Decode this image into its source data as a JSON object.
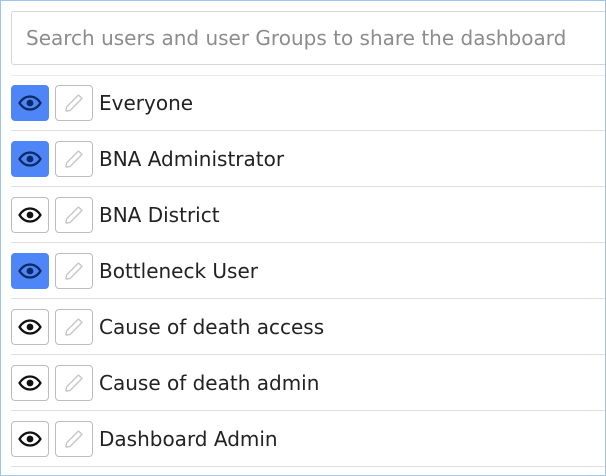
{
  "search": {
    "placeholder": "Search users and user Groups to share the dashboard"
  },
  "colors": {
    "accent": "#4f86f7",
    "border": "#bdbdbd"
  },
  "icons": {
    "view": "eye-icon",
    "edit": "pencil-icon"
  },
  "groups": [
    {
      "label": "Everyone",
      "view_enabled": true
    },
    {
      "label": "BNA Administrator",
      "view_enabled": true
    },
    {
      "label": "BNA District",
      "view_enabled": false
    },
    {
      "label": "Bottleneck User",
      "view_enabled": true
    },
    {
      "label": "Cause of death access",
      "view_enabled": false
    },
    {
      "label": "Cause of death admin",
      "view_enabled": false
    },
    {
      "label": "Dashboard Admin",
      "view_enabled": false
    }
  ]
}
